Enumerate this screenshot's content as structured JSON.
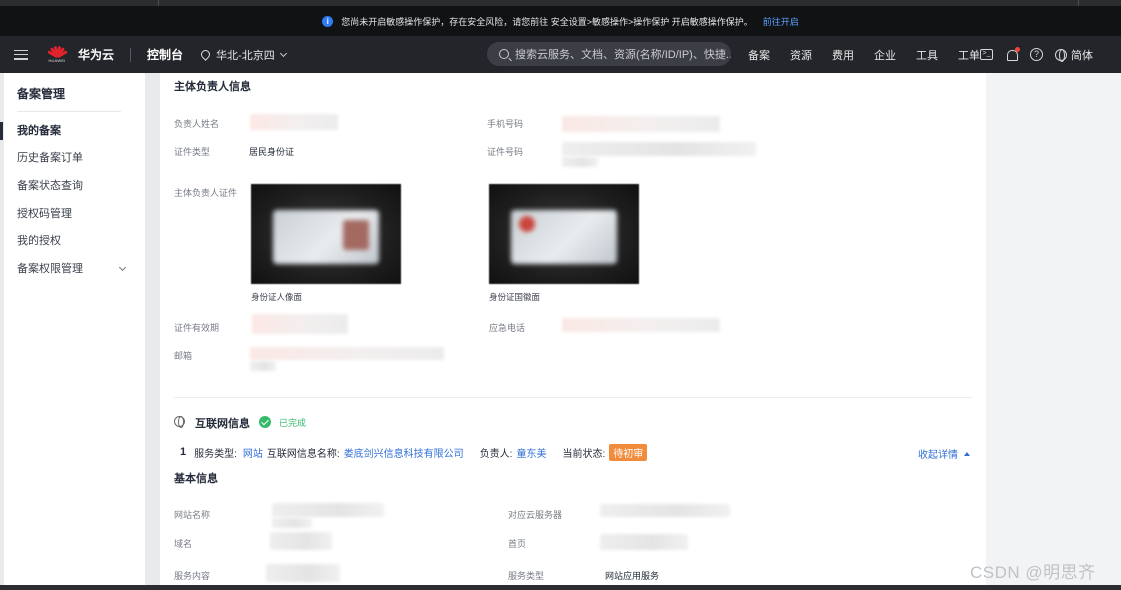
{
  "banner": {
    "message": "您尚未开启敏感操作保护，存在安全风险，请您前往 安全设置>敏感操作>操作保护 开启敏感操作保护。",
    "link": "前往开启"
  },
  "nav": {
    "brand_word": "HUAWEI",
    "brand": "华为云",
    "console": "控制台",
    "region": "华北-北京四",
    "search_placeholder": "搜索云服务、文档、资源(名称/ID/IP)、快捷...",
    "links": [
      "备案",
      "资源",
      "费用",
      "企业",
      "工具",
      "工单"
    ],
    "language": "简体"
  },
  "sidebar": {
    "title": "备案管理",
    "items": [
      {
        "label": "我的备案",
        "active": true
      },
      {
        "label": "历史备案订单",
        "active": false
      },
      {
        "label": "备案状态查询",
        "active": false
      },
      {
        "label": "授权码管理",
        "active": false
      },
      {
        "label": "我的授权",
        "active": false
      },
      {
        "label": "备案权限管理",
        "active": false
      }
    ]
  },
  "principal": {
    "section_title": "主体负责人信息",
    "name_label": "负责人姓名",
    "phone_label": "手机号码",
    "id_type_label": "证件类型",
    "id_type_value": "居民身份证",
    "id_number_label": "证件号码",
    "id_doc_label": "主体负责人证件",
    "id_front_caption": "身份证人像面",
    "id_back_caption": "身份证国徽面",
    "validity_label": "证件有效期",
    "emergency_label": "应急电话",
    "email_label": "邮箱"
  },
  "internet": {
    "section_title": "互联网信息",
    "status": "已完成",
    "index": "1",
    "service_type_label": "服务类型:",
    "service_type_value": "网站",
    "info_name_label": "互联网信息名称:",
    "info_name_value": "娄底剑兴信息科技有限公司",
    "owner_label": "负责人:",
    "owner_value": "童东美",
    "state_label": "当前状态:",
    "state_value": "待初审",
    "collapse_label": "收起详情"
  },
  "basic": {
    "section_title": "基本信息",
    "site_name_label": "网站名称",
    "cloud_server_label": "对应云服务器",
    "domain_label": "域名",
    "homepage_label": "首页",
    "service_content_label": "服务内容",
    "service_type_label": "服务类型",
    "service_type_value": "网站应用服务"
  },
  "watermark": "CSDN @明思齐",
  "colors": {
    "nav_bg": "#23252a",
    "accent_blue": "#2f6fd6",
    "success_green": "#35b96b",
    "badge_orange": "#f08c3c",
    "huawei_red": "#e0232d"
  }
}
